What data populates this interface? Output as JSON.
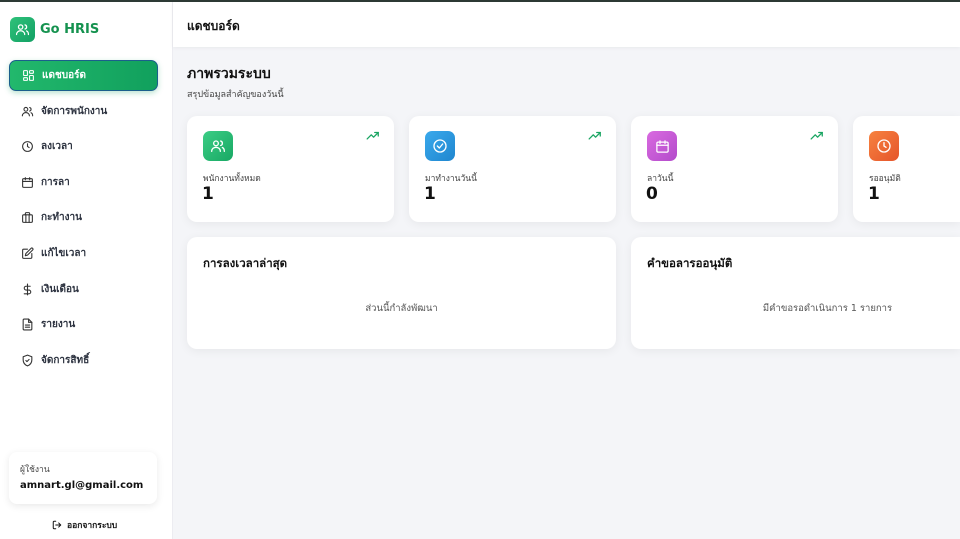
{
  "app": {
    "name": "Go HRIS"
  },
  "header": {
    "title": "แดชบอร์ด"
  },
  "sidebar": {
    "items": [
      {
        "label": "แดชบอร์ด",
        "icon": "dashboard-icon",
        "active": true
      },
      {
        "label": "จัดการพนักงาน",
        "icon": "users-icon"
      },
      {
        "label": "ลงเวลา",
        "icon": "clock-icon"
      },
      {
        "label": "การลา",
        "icon": "calendar-icon"
      },
      {
        "label": "กะทำงาน",
        "icon": "briefcase-icon"
      },
      {
        "label": "แก้ไขเวลา",
        "icon": "edit-icon"
      },
      {
        "label": "เงินเดือน",
        "icon": "dollar-icon"
      },
      {
        "label": "รายงาน",
        "icon": "report-icon"
      },
      {
        "label": "จัดการสิทธิ์",
        "icon": "shield-icon"
      }
    ],
    "user": {
      "role_label": "ผู้ใช้งาน",
      "email": "amnart.gl@gmail.com"
    },
    "logout_label": "ออกจากระบบ"
  },
  "main": {
    "title": "ภาพรวมระบบ",
    "subtitle": "สรุปข้อมูลสำคัญของวันนี้",
    "stats": [
      {
        "label": "พนักงานทั้งหมด",
        "value": "1",
        "icon": "users-icon",
        "color": "#2fc27a"
      },
      {
        "label": "มาทำงานวันนี้",
        "value": "1",
        "icon": "check-circle-icon",
        "color": "#2b9be0"
      },
      {
        "label": "ลาวันนี้",
        "value": "0",
        "icon": "calendar-icon",
        "color": "#c55ad6"
      },
      {
        "label": "รออนุมัติ",
        "value": "1",
        "icon": "clock-icon",
        "color": "#ef6a35"
      }
    ],
    "panels": [
      {
        "title": "การลงเวลาล่าสุด",
        "body": "ส่วนนี้กำลังพัฒนา"
      },
      {
        "title": "คำขอลารออนุมัติ",
        "body": "มีคำขอรอดำเนินการ 1 รายการ"
      }
    ]
  },
  "colors": {
    "brand": "#15924f",
    "trend": "#1aa562"
  }
}
